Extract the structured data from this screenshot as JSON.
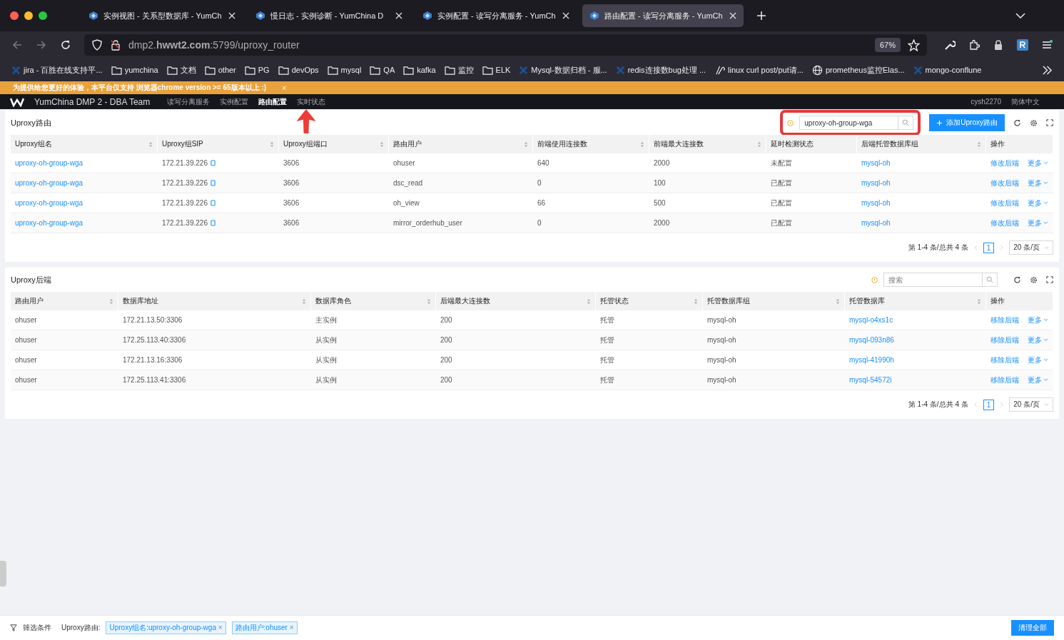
{
  "browser": {
    "tabs": [
      {
        "title": "实例视图 - 关系型数据库 - YumCh",
        "selected": false
      },
      {
        "title": "慢日志 - 实例诊断 - YumChina D",
        "selected": false
      },
      {
        "title": "实例配置 - 读写分离服务 - YumCh",
        "selected": false
      },
      {
        "title": "路由配置 - 读写分离服务 - YumCh",
        "selected": true
      }
    ],
    "url": "dmp2.**hwwt2.com**:5799/uproxy_router",
    "zoom": "67%",
    "bookmarks": [
      {
        "kind": "site",
        "label": "jira - 百胜在线支持平..."
      },
      {
        "kind": "folder",
        "label": "yumchina"
      },
      {
        "kind": "folder",
        "label": "文档"
      },
      {
        "kind": "folder",
        "label": "other"
      },
      {
        "kind": "folder",
        "label": "PG"
      },
      {
        "kind": "folder",
        "label": "devOps"
      },
      {
        "kind": "folder",
        "label": "mysql"
      },
      {
        "kind": "folder",
        "label": "QA"
      },
      {
        "kind": "folder",
        "label": "kafka"
      },
      {
        "kind": "folder",
        "label": "监控"
      },
      {
        "kind": "folder",
        "label": "ELK"
      },
      {
        "kind": "site",
        "label": "Mysql-数据归档 - 服..."
      },
      {
        "kind": "site",
        "label": "redis连接数bug处理 ..."
      },
      {
        "kind": "curl",
        "label": "linux curl post/put请..."
      },
      {
        "kind": "globe",
        "label": "prometheus监控Elas..."
      },
      {
        "kind": "site",
        "label": "mongo-conflune"
      }
    ]
  },
  "banner": {
    "text": "为提供给您更好的体验，本平台仅支持 浏览器chrome version >= 65版本以上 :)",
    "close": "×"
  },
  "app_header": {
    "title": "YumChina DMP 2 - DBA Team",
    "nav": [
      {
        "label": "读写分离服务",
        "selected": false
      },
      {
        "label": "实例配置",
        "selected": false
      },
      {
        "label": "路由配置",
        "selected": true
      },
      {
        "label": "实时状态",
        "selected": false
      }
    ],
    "user": "cysh2270",
    "language": "简体中文"
  },
  "panels": [
    {
      "title": "Uproxy路由",
      "search": {
        "value": "uproxy-oh-group-wga"
      },
      "highlighted": true,
      "add_button": "添加Uproxy路由",
      "columns": [
        {
          "label": "Uproxy组名",
          "kind": "link",
          "sortable": true
        },
        {
          "label": "Uproxy组SIP",
          "kind": "copy",
          "sortable": true
        },
        {
          "label": "Uproxy组端口",
          "kind": "text",
          "sortable": true
        },
        {
          "label": "路由用户",
          "kind": "text",
          "sortable": true
        },
        {
          "label": "前端使用连接数",
          "kind": "text",
          "sortable": true
        },
        {
          "label": "前端最大连接数",
          "kind": "text",
          "sortable": true
        },
        {
          "label": "延时检测状态",
          "kind": "text",
          "sortable": false
        },
        {
          "label": "后端托管数据库组",
          "kind": "link",
          "sortable": true
        },
        {
          "label": "操作",
          "kind": "actions",
          "sortable": false
        }
      ],
      "rows": [
        [
          "uproxy-oh-group-wga",
          "172.21.39.226",
          "3606",
          "ohuser",
          "640",
          "2000",
          "未配置",
          "mysql-oh",
          [
            "修改后端",
            "更多"
          ]
        ],
        [
          "uproxy-oh-group-wga",
          "172.21.39.226",
          "3606",
          "dsc_read",
          "0",
          "100",
          "已配置",
          "mysql-oh",
          [
            "修改后端",
            "更多"
          ]
        ],
        [
          "uproxy-oh-group-wga",
          "172.21.39.226",
          "3606",
          "oh_view",
          "66",
          "500",
          "已配置",
          "mysql-oh",
          [
            "修改后端",
            "更多"
          ]
        ],
        [
          "uproxy-oh-group-wga",
          "172.21.39.226",
          "3606",
          "mirror_orderhub_user",
          "0",
          "2000",
          "已配置",
          "mysql-oh",
          [
            "修改后端",
            "更多"
          ]
        ]
      ],
      "pagination": {
        "summary": "第 1-4 条/总共 4 条",
        "page": "1",
        "page_size": "20 条/页"
      }
    },
    {
      "title": "Uproxy后端",
      "search": {
        "placeholder": "搜索"
      },
      "highlighted": false,
      "columns": [
        {
          "label": "路由用户",
          "kind": "text",
          "sortable": true
        },
        {
          "label": "数据库地址",
          "kind": "text",
          "sortable": true
        },
        {
          "label": "数据库角色",
          "kind": "text",
          "sortable": true
        },
        {
          "label": "后端最大连接数",
          "kind": "text",
          "sortable": true
        },
        {
          "label": "托管状态",
          "kind": "text",
          "sortable": true
        },
        {
          "label": "托管数据库组",
          "kind": "text",
          "sortable": true
        },
        {
          "label": "托管数据库",
          "kind": "link",
          "sortable": true
        },
        {
          "label": "操作",
          "kind": "actions",
          "sortable": false
        }
      ],
      "rows": [
        [
          "ohuser",
          "172.21.13.50:3306",
          "主实例",
          "200",
          "托管",
          "mysql-oh",
          "mysql-o4xs1c",
          [
            "移除后端",
            "更多"
          ]
        ],
        [
          "ohuser",
          "172.25.113.40:3306",
          "从实例",
          "200",
          "托管",
          "mysql-oh",
          "mysql-093n86",
          [
            "移除后端",
            "更多"
          ]
        ],
        [
          "ohuser",
          "172.21.13.16:3306",
          "从实例",
          "200",
          "托管",
          "mysql-oh",
          "mysql-41990h",
          [
            "移除后端",
            "更多"
          ]
        ],
        [
          "ohuser",
          "172.25.113.41:3306",
          "从实例",
          "200",
          "托管",
          "mysql-oh",
          "mysql-54572i",
          [
            "移除后端",
            "更多"
          ]
        ]
      ],
      "pagination": {
        "summary": "第 1-4 条/总共 4 条",
        "page": "1",
        "page_size": "20 条/页"
      }
    }
  ],
  "filter_bar": {
    "label": "筛选条件",
    "group": "Uproxy路由:",
    "tags": [
      {
        "label": "Uproxy组名:uproxy-oh-group-wga",
        "close": "×"
      },
      {
        "label": "路由用户:ohuser",
        "close": "×"
      }
    ],
    "clear_button": "清理全部"
  }
}
